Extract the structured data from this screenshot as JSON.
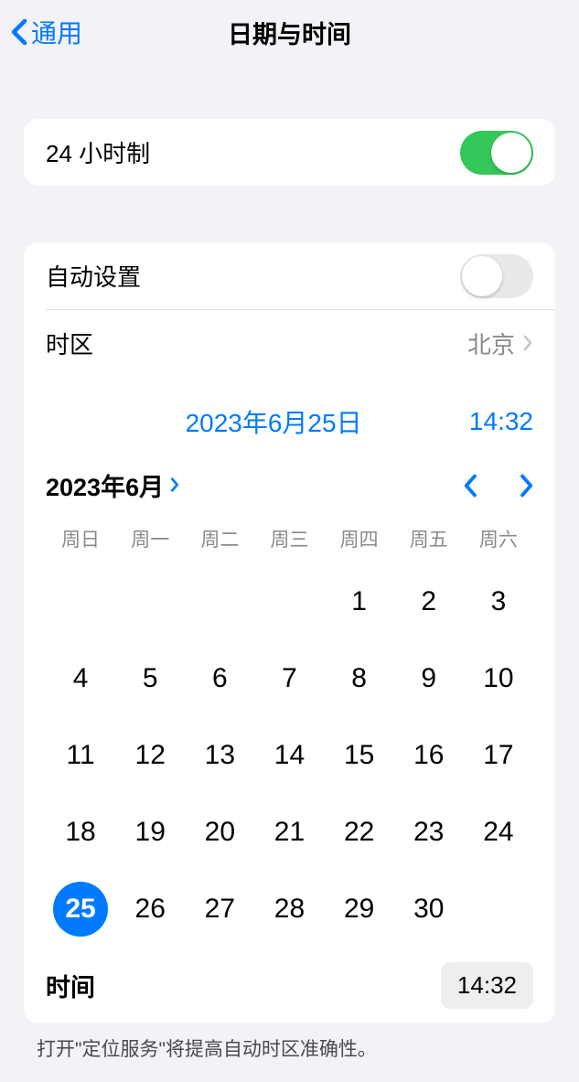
{
  "nav": {
    "back_label": "通用",
    "title": "日期与时间"
  },
  "group1": {
    "twenty_four_hour_label": "24 小时制",
    "twenty_four_hour_on": true
  },
  "group2": {
    "auto_set_label": "自动设置",
    "auto_set_on": false,
    "timezone_label": "时区",
    "timezone_value": "北京"
  },
  "datetime": {
    "date_display": "2023年6月25日",
    "time_display": "14:32"
  },
  "calendar": {
    "month_label": "2023年6月",
    "weekdays": [
      "周日",
      "周一",
      "周二",
      "周三",
      "周四",
      "周五",
      "周六"
    ],
    "leading_blanks": 4,
    "days": [
      1,
      2,
      3,
      4,
      5,
      6,
      7,
      8,
      9,
      10,
      11,
      12,
      13,
      14,
      15,
      16,
      17,
      18,
      19,
      20,
      21,
      22,
      23,
      24,
      25,
      26,
      27,
      28,
      29,
      30
    ],
    "selected_day": 25
  },
  "time_row": {
    "label": "时间",
    "value": "14:32"
  },
  "footer": {
    "note": "打开\"定位服务\"将提高自动时区准确性。"
  }
}
